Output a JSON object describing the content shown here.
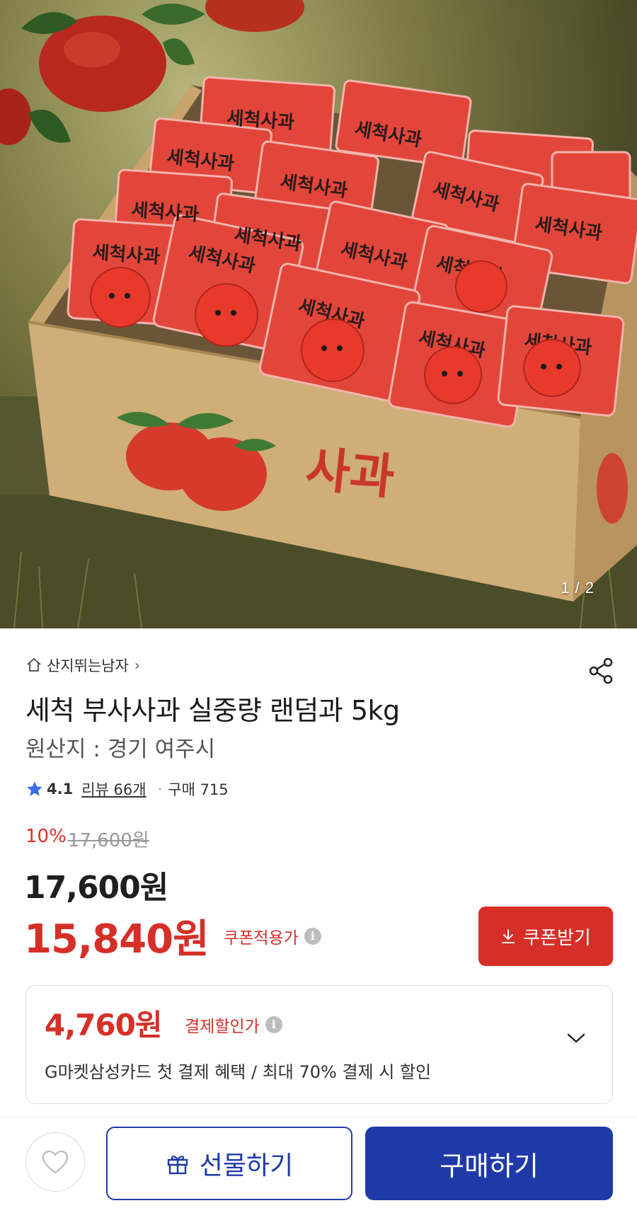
{
  "hero": {
    "image_counter": "1 / 2",
    "box_label": "사과",
    "pack_label": "세척사과"
  },
  "store": {
    "name": "산지뛰는남자",
    "chevron": "›",
    "home_icon": "home-icon",
    "share_icon": "share-icon"
  },
  "product": {
    "title": "세척 부사사과 실중량 랜덤과 5kg",
    "origin": "원산지 : 경기 여주시"
  },
  "rating": {
    "score": "4.1",
    "review": "리뷰 66개",
    "separator": "·",
    "purchases": "구매 715"
  },
  "pricing": {
    "discount_rate": "10%",
    "original_price": "17,600원",
    "price": "17,600원",
    "coupon_price": "15,840원",
    "coupon_label": "쿠폰적용가",
    "coupon_button": "쿠폰받기"
  },
  "payment": {
    "price": "4,760원",
    "label": "결제할인가",
    "description": "G마켓삼성카드 첫 결제 혜택 / 최대 70% 결제 시 할인"
  },
  "bottom_bar": {
    "gift_label": "선물하기",
    "buy_label": "구매하기"
  },
  "colors": {
    "accent_red": "#d62f28",
    "brand_blue": "#1f3aa8",
    "star_blue": "#3b6ce6"
  }
}
